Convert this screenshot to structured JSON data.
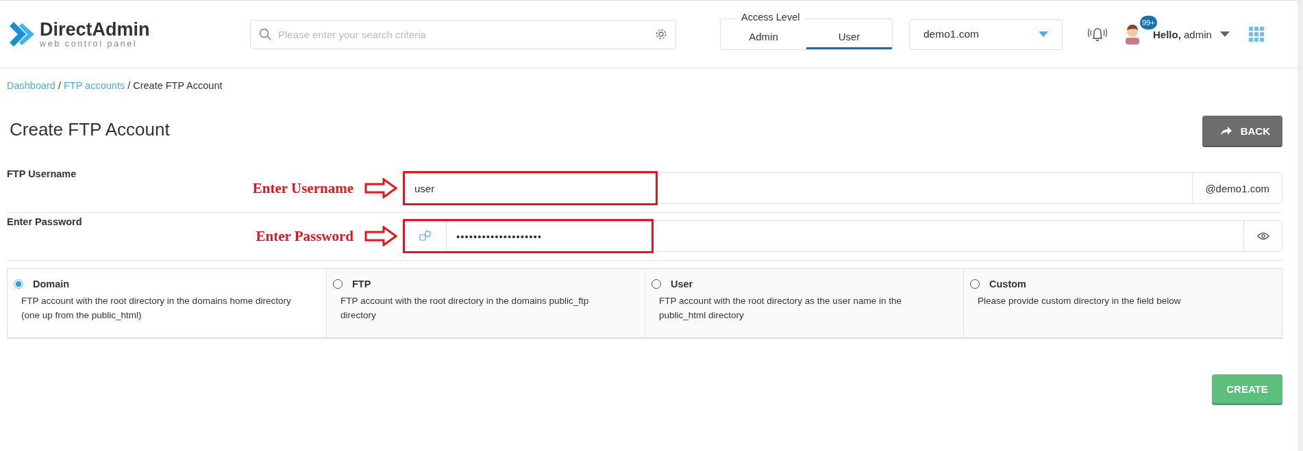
{
  "header": {
    "logo": {
      "name": "DirectAdmin",
      "tagline": "web control panel"
    },
    "search": {
      "placeholder": "Please enter your search criteria"
    },
    "access_level": {
      "legend": "Access Level",
      "tabs": [
        {
          "label": "Admin",
          "selected": false
        },
        {
          "label": "User",
          "selected": true
        }
      ]
    },
    "domain_select": {
      "value": "demo1.com"
    },
    "notifications": {
      "badge": "99+"
    },
    "user_menu": {
      "greeting": "**Hello,** admin"
    }
  },
  "breadcrumb": [
    {
      "label": "Dashboard",
      "link": true
    },
    {
      "separator": "/",
      "label": "FTP accounts",
      "link": true
    },
    {
      "separator": "/",
      "label": "Create FTP Account",
      "link": false
    }
  ],
  "page_title": "Create FTP Account",
  "back_button": "BACK",
  "form": {
    "username": {
      "label": "FTP Username",
      "annotation": "Enter Username",
      "value": "user",
      "suffix": "@demo1.com"
    },
    "password": {
      "label": "Enter Password",
      "annotation": "Enter Password",
      "value": "••••••••••••••••••••"
    }
  },
  "directory_options": [
    {
      "label": "Domain",
      "description": "FTP account with the root directory in the domains home directory (one up from the public_html)",
      "selected": true
    },
    {
      "label": "FTP",
      "description": "FTP account with the root directory in the domains public_ftp directory",
      "selected": false
    },
    {
      "label": "User",
      "description": "FTP account with the root directory as the user name in the public_html directory",
      "selected": false
    },
    {
      "label": "Custom",
      "description": "Please provide custom directory in the field below",
      "selected": false
    }
  ],
  "create_button": "CREATE"
}
